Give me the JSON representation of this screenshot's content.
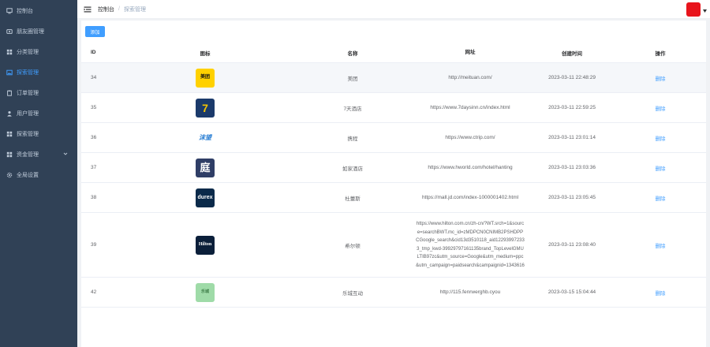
{
  "sidebar": {
    "items": [
      {
        "label": "控制台",
        "icon": "dashboard-icon",
        "active": false
      },
      {
        "label": "朋友圈管理",
        "icon": "moments-icon",
        "active": false
      },
      {
        "label": "分类管理",
        "icon": "grid-icon",
        "active": false
      },
      {
        "label": "探索管理",
        "icon": "image-icon",
        "active": true
      },
      {
        "label": "订单管理",
        "icon": "clipboard-icon",
        "active": false
      },
      {
        "label": "用户管理",
        "icon": "user-icon",
        "active": false
      },
      {
        "label": "探索管理",
        "icon": "grid-icon",
        "active": false
      },
      {
        "label": "资金管理",
        "icon": "grid-icon",
        "active": false,
        "expandable": true
      },
      {
        "label": "全局设置",
        "icon": "gear-icon",
        "active": false
      }
    ]
  },
  "breadcrumb": {
    "home": "控制台",
    "separator": "/",
    "current": "探索管理"
  },
  "toolbar": {
    "add_label": "添加"
  },
  "table": {
    "headers": {
      "id": "ID",
      "logo": "图标",
      "name": "名称",
      "url": "网址",
      "created": "创建时间",
      "action": "操作"
    },
    "rows": [
      {
        "id": "34",
        "name": "美团",
        "url": "http://meituan.com/",
        "created": "2023-03-11 22:48:29",
        "action": "删除",
        "logo_text": "美团",
        "logo_bg": "#ffd100",
        "logo_fg": "#111111"
      },
      {
        "id": "35",
        "name": "7天酒店",
        "url": "https://www.7daysinn.cn/index.html",
        "created": "2023-03-11 22:59:25",
        "action": "删除",
        "logo_text": "7",
        "logo_bg": "#1b3a6b",
        "logo_fg": "#f5c400"
      },
      {
        "id": "36",
        "name": "携程",
        "url": "https://www.ctrip.com/",
        "created": "2023-03-11 23:01:14",
        "action": "删除",
        "logo_text": "沫望",
        "logo_bg": "#ffffff",
        "logo_fg": "#2a7fd4"
      },
      {
        "id": "37",
        "name": "如家酒店",
        "url": "https://www.hworld.com/hotel/hanting",
        "created": "2023-03-11 23:03:36",
        "action": "删除",
        "logo_text": "庭",
        "logo_bg": "#2f3e66",
        "logo_fg": "#ffffff"
      },
      {
        "id": "38",
        "name": "杜蕾斯",
        "url": "https://mall.jd.com/index-1000001402.html",
        "created": "2023-03-11 23:05:45",
        "action": "删除",
        "logo_text": "durex",
        "logo_bg": "#0b2a4a",
        "logo_fg": "#ffffff"
      },
      {
        "id": "39",
        "name": "希尔顿",
        "url": "https://www.hilton.com.cn/zh-cn/?WT.srch=1&source=searchBWT.mc_id=zMDPCN0CNIMB2PSHDPPCGoogle_search&cid13d3510118_aid122939972333_tmp_kwd-39929797161135brand_TopLevelGMULTIB97zc&utm_source=Google&utm_medium=ppc&utm_campaign=paidsearch&campaignid=1343616",
        "created": "2023-03-11 23:08:40",
        "action": "删除",
        "logo_text": "Hilton",
        "logo_bg": "#0b1f3a",
        "logo_fg": "#ffffff"
      },
      {
        "id": "42",
        "name": "乐城互动",
        "url": "http://115.fenrwerghb.cyou",
        "created": "2023-03-15 15:04:44",
        "action": "删除",
        "logo_text": "乐城",
        "logo_bg": "#9fdba8",
        "logo_fg": "#3b7a45"
      }
    ]
  },
  "colors": {
    "sidebar_bg": "#304156",
    "sidebar_text": "#bfcbd9",
    "accent": "#409eff",
    "avatar": "#e8141c"
  }
}
